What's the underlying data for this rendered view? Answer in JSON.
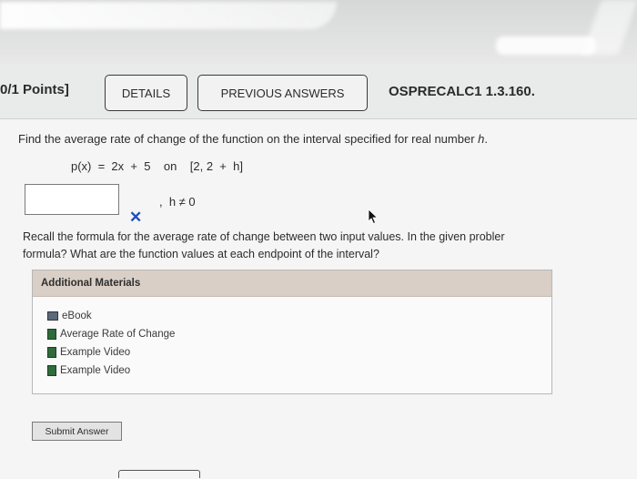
{
  "header": {
    "points": "0/1 Points]",
    "details_label": "DETAILS",
    "previous_answers_label": "PREVIOUS ANSWERS",
    "question_id": "OSPRECALC1 1.3.160."
  },
  "question": {
    "prompt_text": "Find the average rate of change of the function on the interval specified for real number ",
    "prompt_var": "h",
    "prompt_end": ".",
    "function_text": "p(x)  =  2x  +  5    on    [2, 2  +  h]",
    "answer_value": "",
    "incorrect_mark": "✕",
    "condition": ",  h ≠ 0"
  },
  "hint": {
    "line1": "Recall the formula for the average rate of change between two input values. In the given probler",
    "line2": "formula? What are the function values at each endpoint of the interval?"
  },
  "additional_materials": {
    "title": "Additional Materials",
    "items": [
      {
        "label": "eBook",
        "icon": "book-icon"
      },
      {
        "label": "Average Rate of Change",
        "icon": "video-icon"
      },
      {
        "label": "Example Video",
        "icon": "video-icon"
      },
      {
        "label": "Example Video",
        "icon": "video-icon"
      }
    ]
  },
  "submit_label": "Submit Answer",
  "colors": {
    "incorrect": "#1d4fb8",
    "materials_header": "#d9cfc6"
  }
}
